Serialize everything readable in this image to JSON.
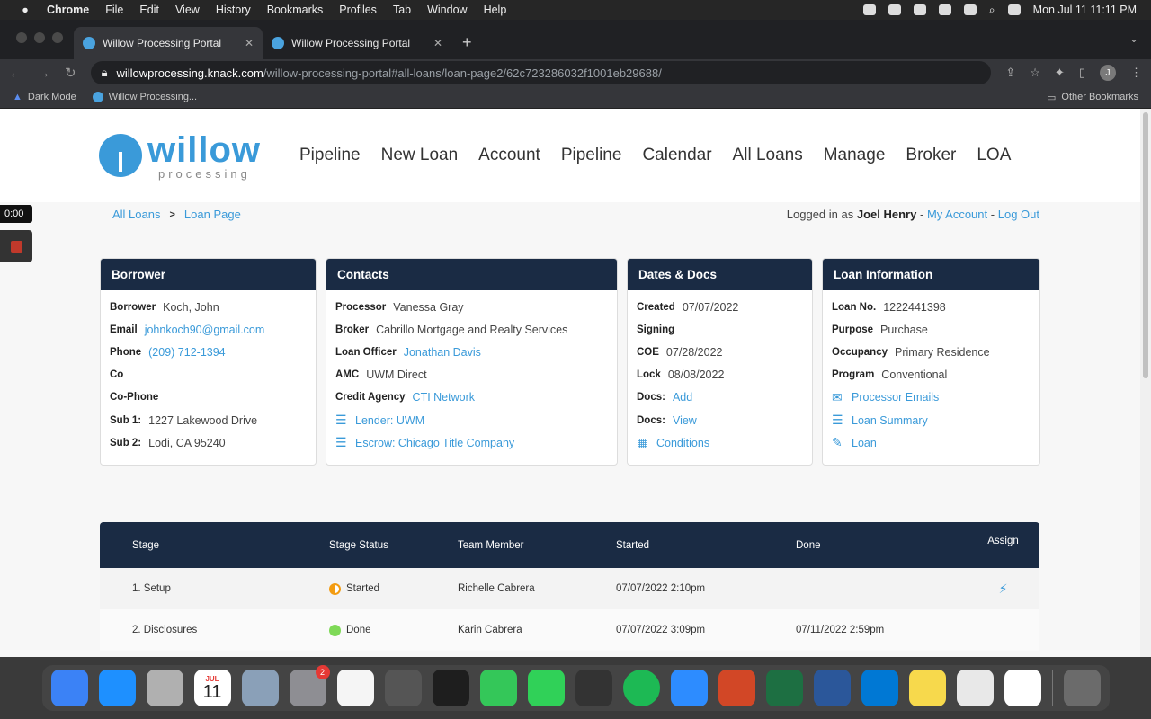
{
  "macbar": {
    "app": "Chrome",
    "menus": [
      "File",
      "Edit",
      "View",
      "History",
      "Bookmarks",
      "Profiles",
      "Tab",
      "Window",
      "Help"
    ],
    "clock": "Mon Jul 11  11:11 PM"
  },
  "browser": {
    "tabs": [
      {
        "title": "Willow Processing Portal"
      },
      {
        "title": "Willow Processing Portal"
      }
    ],
    "url_host": "willowprocessing.knack.com",
    "url_path": "/willow-processing-portal#all-loans/loan-page2/62c723286032f1001eb29688/",
    "profile_initial": "J",
    "bookmarks": [
      "Dark Mode",
      "Willow Processing..."
    ],
    "other_bookmarks": "Other Bookmarks"
  },
  "recorder": {
    "time": "0:00"
  },
  "site": {
    "logo_word": "willow",
    "logo_sub": "processing",
    "nav": [
      "Pipeline",
      "New Loan",
      "Account",
      "Pipeline",
      "Calendar",
      "All Loans",
      "Manage",
      "Broker",
      "LOA"
    ]
  },
  "breadcrumb": {
    "root": "All Loans",
    "current": "Loan Page",
    "login_prefix": "Logged in as",
    "user": "Joel Henry",
    "dash": "-",
    "my_account": "My Account",
    "logout": "Log Out"
  },
  "borrower": {
    "title": "Borrower",
    "borrower_label": "Borrower",
    "borrower_value": "Koch, John",
    "email_label": "Email",
    "email_value": "johnkoch90@gmail.com",
    "phone_label": "Phone",
    "phone_value": "(209) 712-1394",
    "co_label": "Co",
    "cophone_label": "Co-Phone",
    "sub1_label": "Sub 1:",
    "sub1_value": "1227 Lakewood Drive",
    "sub2_label": "Sub 2:",
    "sub2_value": "Lodi, CA 95240"
  },
  "contacts": {
    "title": "Contacts",
    "processor_label": "Processor",
    "processor_value": "Vanessa Gray",
    "broker_label": "Broker",
    "broker_value": "Cabrillo Mortgage and Realty Services",
    "lo_label": "Loan Officer",
    "lo_value": "Jonathan Davis",
    "amc_label": "AMC",
    "amc_value": "UWM Direct",
    "credit_label": "Credit Agency",
    "credit_value": "CTI Network",
    "lender_link": "Lender: UWM",
    "escrow_link": "Escrow: Chicago Title Company"
  },
  "dates": {
    "title": "Dates & Docs",
    "created_label": "Created",
    "created_value": "07/07/2022",
    "signing_label": "Signing",
    "coe_label": "COE",
    "coe_value": "07/28/2022",
    "lock_label": "Lock",
    "lock_value": "08/08/2022",
    "docs_label": "Docs:",
    "docs_add": "Add",
    "docs2_label": "Docs:",
    "docs_view": "View",
    "conditions": "Conditions"
  },
  "loaninfo": {
    "title": "Loan Information",
    "loanno_label": "Loan No.",
    "loanno_value": "1222441398",
    "purpose_label": "Purpose",
    "purpose_value": "Purchase",
    "occupancy_label": "Occupancy",
    "occupancy_value": "Primary Residence",
    "program_label": "Program",
    "program_value": "Conventional",
    "processor_emails": "Processor Emails",
    "loan_summary": "Loan Summary",
    "loan_link": "Loan"
  },
  "stages": {
    "headers": [
      "Stage",
      "Stage Status",
      "Team Member",
      "Started",
      "Done",
      "Assign"
    ],
    "rows": [
      {
        "stage": "1. Setup",
        "status": "Started",
        "status_color": "#f39c12",
        "member": "Richelle Cabrera",
        "started": "07/07/2022 2:10pm",
        "done": ""
      },
      {
        "stage": "2. Disclosures",
        "status": "Done",
        "status_color": "#7ed957",
        "member": "Karin Cabrera",
        "started": "07/07/2022 3:09pm",
        "done": "07/11/2022 2:59pm"
      }
    ]
  },
  "dock": {
    "apps": [
      "finder-icon",
      "app-store-icon",
      "launchpad-icon",
      "calendar-icon",
      "preview-icon",
      "system-preferences-icon",
      "textedit-icon",
      "calculator-icon",
      "acrobat-icon",
      "messages-icon",
      "facetime-icon",
      "sublime-icon",
      "spotify-icon",
      "zoom-icon",
      "powerpoint-icon",
      "excel-icon",
      "word-icon",
      "outlook-icon",
      "notes-icon",
      "chrome-icon",
      "slack-icon"
    ],
    "calendar_month": "JUL",
    "calendar_day": "11",
    "settings_badge": "2"
  },
  "colors": {
    "accent": "#3a9ad9",
    "header": "#1a2b44"
  }
}
